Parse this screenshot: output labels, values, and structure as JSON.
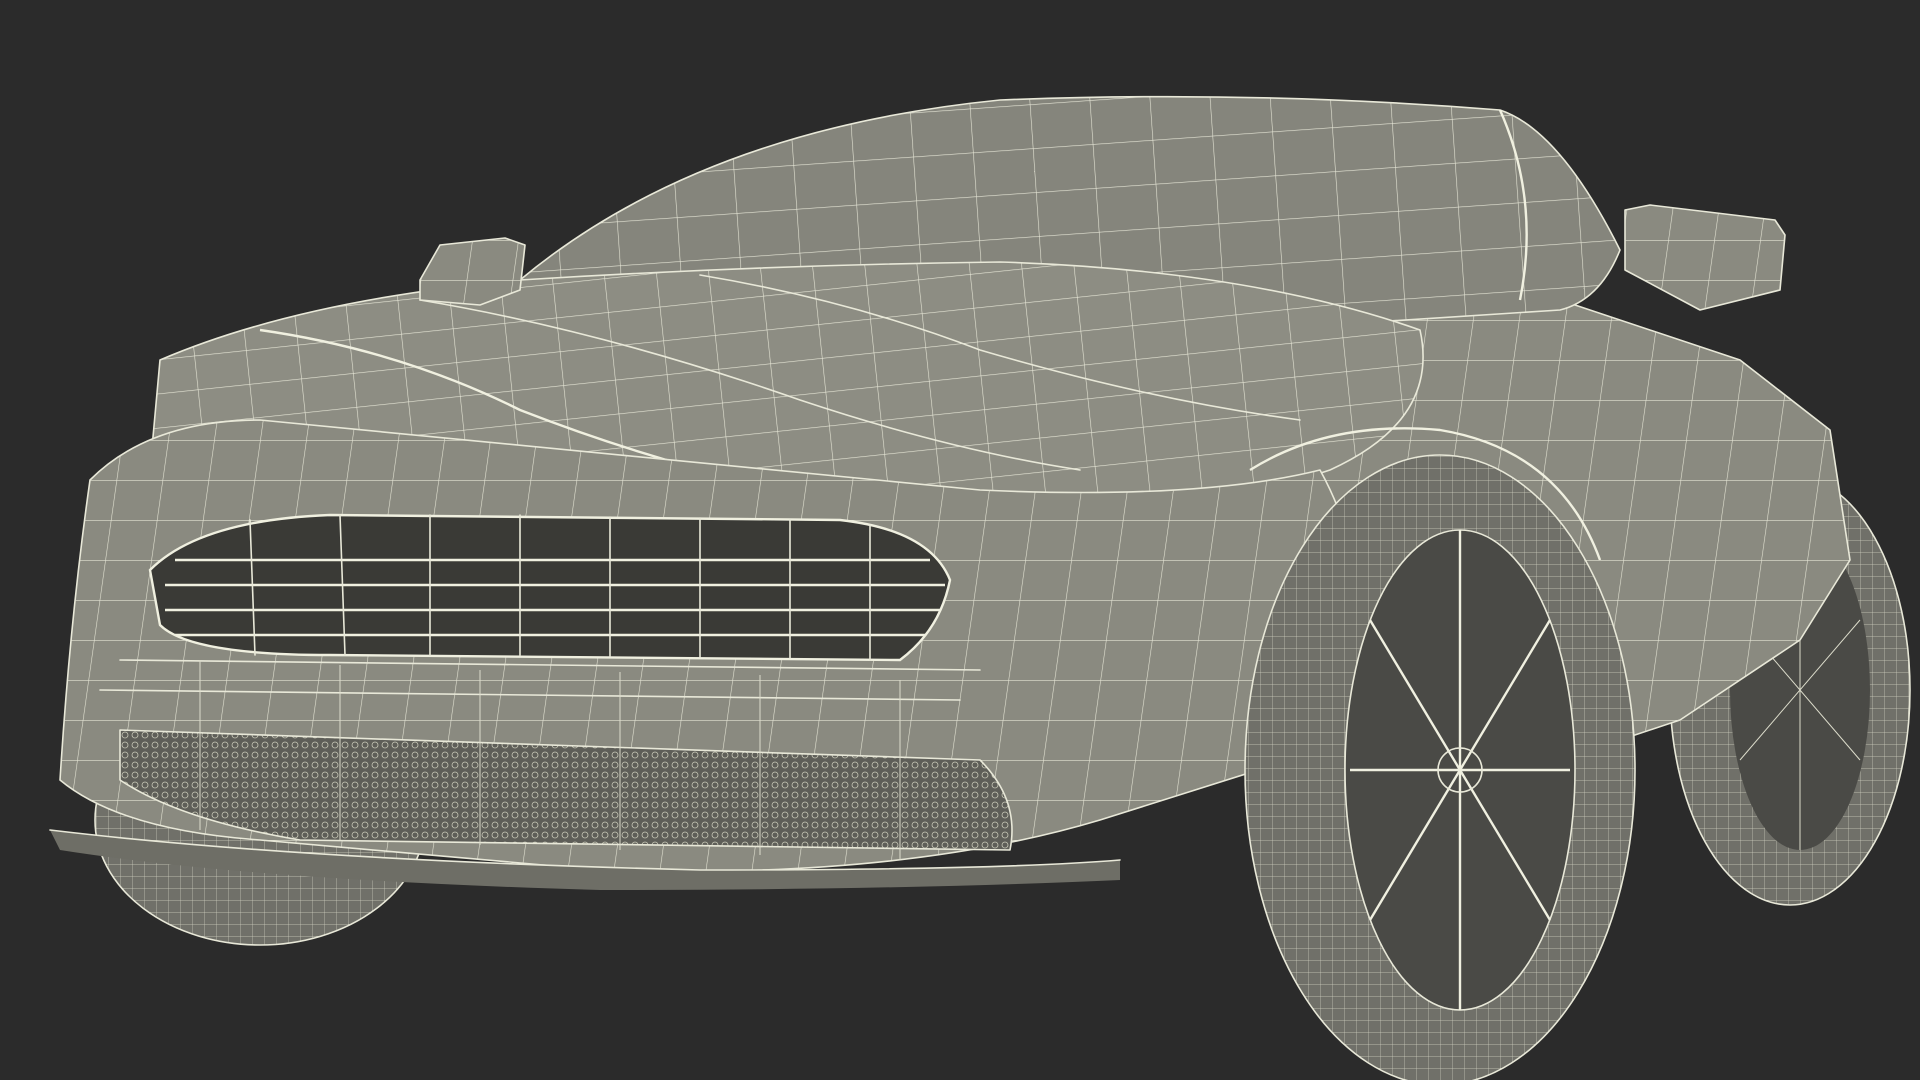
{
  "scene": {
    "subject": "wireframe-car-model",
    "view": "front-three-quarter",
    "background_color": "#2b2b2b",
    "body_color": "#8a8a80",
    "wire_color": "#e8e8d8"
  }
}
